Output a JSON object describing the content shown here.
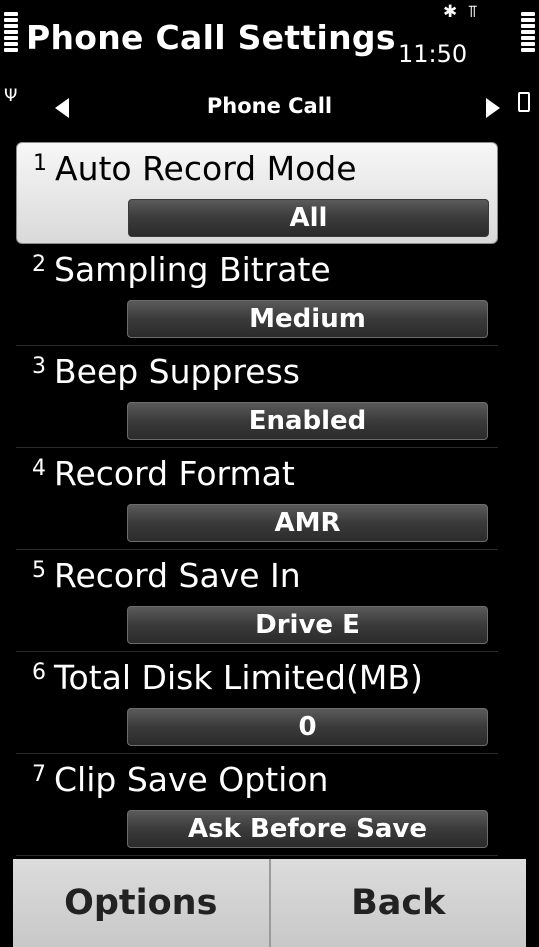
{
  "title": "Phone Call Settings",
  "status": {
    "time": "11:50",
    "icons": [
      "signal-strength-icon",
      "bluetooth-icon",
      "antenna-icon",
      "battery-level-icon"
    ]
  },
  "tab": {
    "label": "Phone Call",
    "icons": [
      "arrow-left-icon",
      "arrow-right-icon"
    ]
  },
  "settings": [
    {
      "num": "1",
      "label": "Auto Record Mode",
      "value": "All"
    },
    {
      "num": "2",
      "label": "Sampling Bitrate",
      "value": "Medium"
    },
    {
      "num": "3",
      "label": "Beep Suppress",
      "value": "Enabled"
    },
    {
      "num": "4",
      "label": "Record Format",
      "value": "AMR"
    },
    {
      "num": "5",
      "label": "Record Save In",
      "value": "Drive E"
    },
    {
      "num": "6",
      "label": "Total Disk Limited(MB)",
      "value": "0"
    },
    {
      "num": "7",
      "label": "Clip Save Option",
      "value": "Ask Before Save"
    }
  ],
  "softkeys": {
    "left": "Options",
    "right": "Back"
  },
  "colors": {
    "background": "#000000",
    "selected_row": "#e6e6e6",
    "value_box": "#3a3a3a",
    "softkey_bg": "#d0d0d0"
  }
}
